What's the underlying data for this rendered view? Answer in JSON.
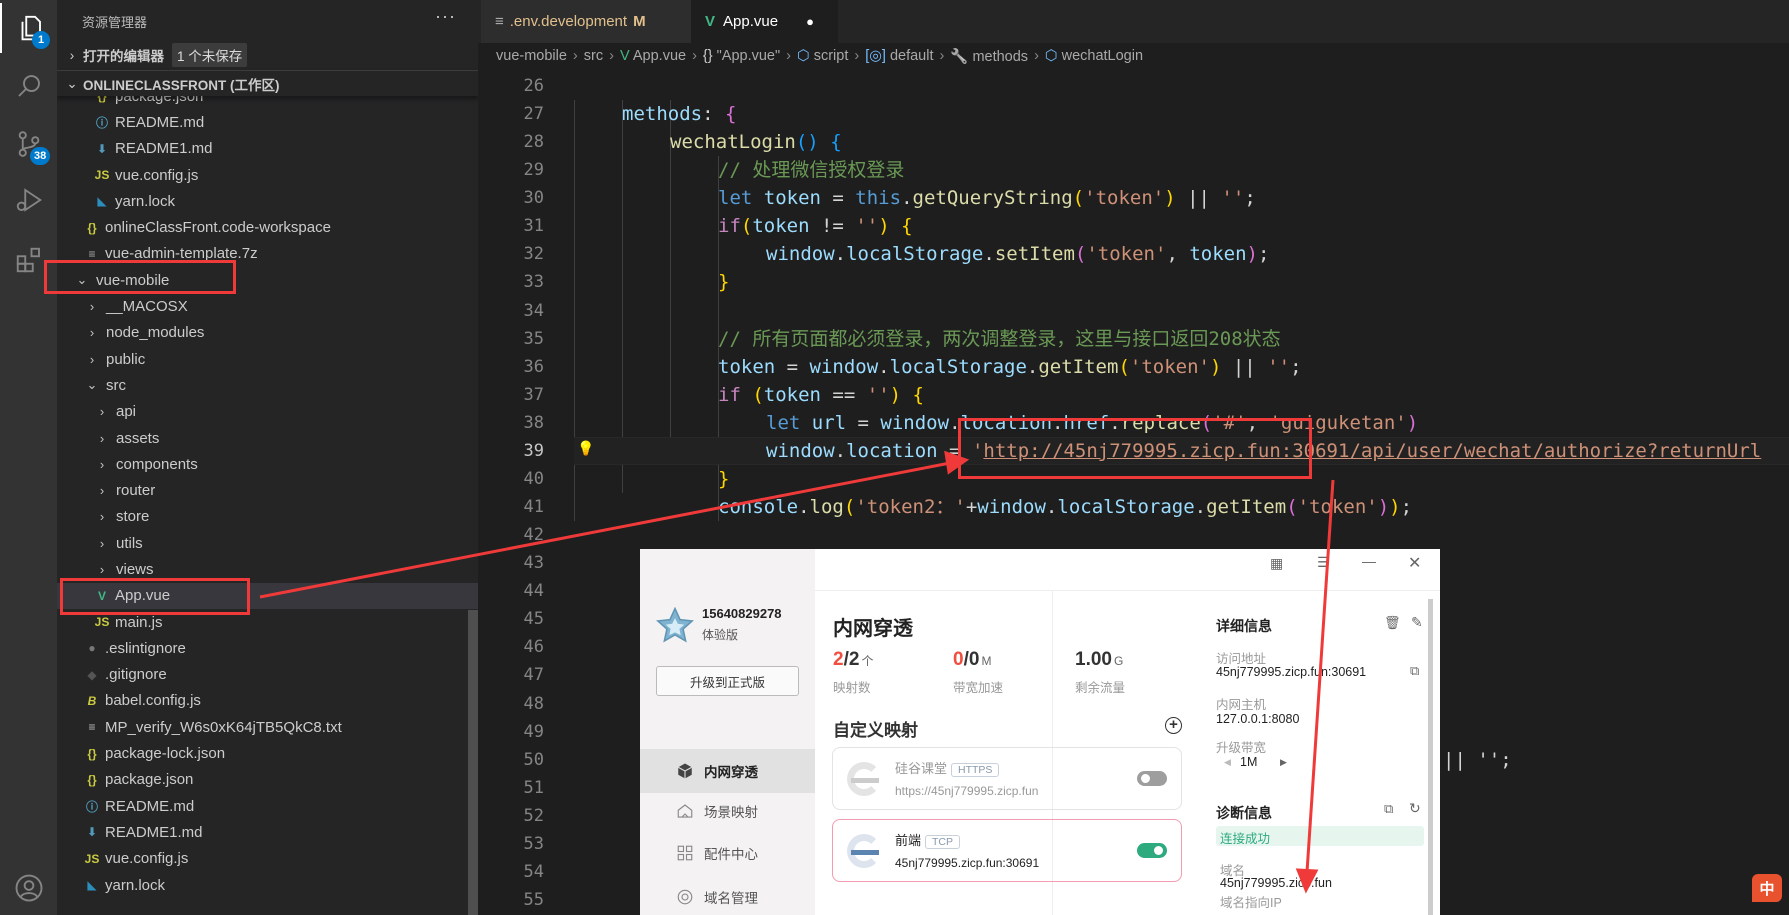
{
  "activity_bar": {
    "items": [
      {
        "icon": "files-icon",
        "badge": "1"
      },
      {
        "icon": "search-icon"
      },
      {
        "icon": "source-control-icon",
        "badge": "38"
      },
      {
        "icon": "run-debug-icon"
      },
      {
        "icon": "extensions-icon"
      }
    ],
    "account_icon": "account-icon"
  },
  "sidebar": {
    "title": "资源管理器",
    "more": "···",
    "open_editors": {
      "label": "打开的编辑器",
      "badge": "1 个未保存"
    },
    "workspace": {
      "label": "ONLINECLASSFRONT (工作区)"
    },
    "tree": [
      {
        "label": "package.json",
        "icon": "json",
        "depth": 2
      },
      {
        "label": "README.md",
        "icon": "info",
        "depth": 2
      },
      {
        "label": "README1.md",
        "icon": "md",
        "depth": 2
      },
      {
        "label": "vue.config.js",
        "icon": "js",
        "depth": 2
      },
      {
        "label": "yarn.lock",
        "icon": "yarn",
        "depth": 2
      },
      {
        "label": "onlineClassFront.code-workspace",
        "icon": "json",
        "depth": 1
      },
      {
        "label": "vue-admin-template.7z",
        "icon": "archive",
        "depth": 1
      },
      {
        "label": "vue-mobile",
        "folder": "open",
        "depth": 0
      },
      {
        "label": "__MACOSX",
        "folder": "closed",
        "depth": 1
      },
      {
        "label": "node_modules",
        "folder": "closed",
        "depth": 1
      },
      {
        "label": "public",
        "folder": "closed",
        "depth": 1
      },
      {
        "label": "src",
        "folder": "open",
        "depth": 1
      },
      {
        "label": "api",
        "folder": "closed",
        "depth": 2
      },
      {
        "label": "assets",
        "folder": "closed",
        "depth": 2
      },
      {
        "label": "components",
        "folder": "closed",
        "depth": 2
      },
      {
        "label": "router",
        "folder": "closed",
        "depth": 2
      },
      {
        "label": "store",
        "folder": "closed",
        "depth": 2
      },
      {
        "label": "utils",
        "folder": "closed",
        "depth": 2
      },
      {
        "label": "views",
        "folder": "closed",
        "depth": 2
      },
      {
        "label": "App.vue",
        "icon": "vue",
        "depth": 2,
        "selected": true
      },
      {
        "label": "main.js",
        "icon": "js",
        "depth": 2
      },
      {
        "label": ".eslintignore",
        "icon": "dot",
        "depth": 1
      },
      {
        "label": ".gitignore",
        "icon": "git",
        "depth": 1
      },
      {
        "label": "babel.config.js",
        "icon": "babel",
        "depth": 1
      },
      {
        "label": "MP_verify_W6s0xK64jTB5QkC8.txt",
        "icon": "txt",
        "depth": 1
      },
      {
        "label": "package-lock.json",
        "icon": "json",
        "depth": 1
      },
      {
        "label": "package.json",
        "icon": "json",
        "depth": 1
      },
      {
        "label": "README.md",
        "icon": "info",
        "depth": 1
      },
      {
        "label": "README1.md",
        "icon": "md",
        "depth": 1
      },
      {
        "label": "vue.config.js",
        "icon": "js",
        "depth": 1
      },
      {
        "label": "yarn.lock",
        "icon": "yarn",
        "depth": 1
      }
    ]
  },
  "tabs": [
    {
      "label": ".env.development",
      "status": "M",
      "icon": "file-lines-icon",
      "active": false
    },
    {
      "label": "App.vue",
      "status": "●",
      "icon": "vue-icon",
      "active": true
    }
  ],
  "breadcrumb": [
    {
      "label": "vue-mobile"
    },
    {
      "label": "src"
    },
    {
      "label": "App.vue",
      "icon": "vue-icon"
    },
    {
      "label": "\"App.vue\"",
      "icon": "braces-icon"
    },
    {
      "label": "script",
      "icon": "cube-icon"
    },
    {
      "label": "default",
      "icon": "module-icon"
    },
    {
      "label": "methods",
      "icon": "wrench-icon"
    },
    {
      "label": "wechatLogin",
      "icon": "cube-icon"
    }
  ],
  "editor": {
    "current_line": 39,
    "lines": [
      {
        "n": "26",
        "indent": 0,
        "tokens": []
      },
      {
        "n": "27",
        "indent": 1,
        "tokens": [
          {
            "t": "methods",
            "k": "var"
          },
          {
            "t": ": ",
            "k": "p"
          },
          {
            "t": "{",
            "k": "b2"
          }
        ]
      },
      {
        "n": "28",
        "indent": 2,
        "tokens": [
          {
            "t": "wechatLogin",
            "k": "fn"
          },
          {
            "t": "()",
            "k": "b3"
          },
          {
            "t": " ",
            "k": "p"
          },
          {
            "t": "{",
            "k": "b3"
          }
        ]
      },
      {
        "n": "29",
        "indent": 3,
        "tokens": [
          {
            "t": "// 处理微信授权登录",
            "k": "cm"
          }
        ]
      },
      {
        "n": "30",
        "indent": 3,
        "tokens": [
          {
            "t": "let ",
            "k": "kw"
          },
          {
            "t": "token",
            "k": "var"
          },
          {
            "t": " = ",
            "k": "p"
          },
          {
            "t": "this",
            "k": "kw"
          },
          {
            "t": ".",
            "k": "p"
          },
          {
            "t": "getQueryString",
            "k": "fn"
          },
          {
            "t": "(",
            "k": "b1"
          },
          {
            "t": "'token'",
            "k": "str"
          },
          {
            "t": ")",
            "k": "b1"
          },
          {
            "t": " || ",
            "k": "p"
          },
          {
            "t": "''",
            "k": "str"
          },
          {
            "t": ";",
            "k": "p"
          }
        ]
      },
      {
        "n": "31",
        "indent": 3,
        "tokens": [
          {
            "t": "if",
            "k": "ctl"
          },
          {
            "t": "(",
            "k": "b1"
          },
          {
            "t": "token",
            "k": "var"
          },
          {
            "t": " != ",
            "k": "p"
          },
          {
            "t": "''",
            "k": "str"
          },
          {
            "t": ")",
            "k": "b1"
          },
          {
            "t": " ",
            "k": "p"
          },
          {
            "t": "{",
            "k": "b1"
          }
        ]
      },
      {
        "n": "32",
        "indent": 4,
        "tokens": [
          {
            "t": "window",
            "k": "var"
          },
          {
            "t": ".",
            "k": "p"
          },
          {
            "t": "localStorage",
            "k": "var"
          },
          {
            "t": ".",
            "k": "p"
          },
          {
            "t": "setItem",
            "k": "fn"
          },
          {
            "t": "(",
            "k": "b2"
          },
          {
            "t": "'token'",
            "k": "str"
          },
          {
            "t": ", ",
            "k": "p"
          },
          {
            "t": "token",
            "k": "var"
          },
          {
            "t": ")",
            "k": "b2"
          },
          {
            "t": ";",
            "k": "p"
          }
        ]
      },
      {
        "n": "33",
        "indent": 3,
        "tokens": [
          {
            "t": "}",
            "k": "b1"
          }
        ]
      },
      {
        "n": "34",
        "indent": 0,
        "tokens": []
      },
      {
        "n": "35",
        "indent": 3,
        "tokens": [
          {
            "t": "// 所有页面都必须登录，两次调整登录，这里与接口返回208状态",
            "k": "cm"
          }
        ]
      },
      {
        "n": "36",
        "indent": 3,
        "tokens": [
          {
            "t": "token",
            "k": "var"
          },
          {
            "t": " = ",
            "k": "p"
          },
          {
            "t": "window",
            "k": "var"
          },
          {
            "t": ".",
            "k": "p"
          },
          {
            "t": "localStorage",
            "k": "var"
          },
          {
            "t": ".",
            "k": "p"
          },
          {
            "t": "getItem",
            "k": "fn"
          },
          {
            "t": "(",
            "k": "b1"
          },
          {
            "t": "'token'",
            "k": "str"
          },
          {
            "t": ")",
            "k": "b1"
          },
          {
            "t": " || ",
            "k": "p"
          },
          {
            "t": "''",
            "k": "str"
          },
          {
            "t": ";",
            "k": "p"
          }
        ]
      },
      {
        "n": "37",
        "indent": 3,
        "tokens": [
          {
            "t": "if",
            "k": "ctl"
          },
          {
            "t": " (",
            "k": "b1"
          },
          {
            "t": "token",
            "k": "var"
          },
          {
            "t": " == ",
            "k": "p"
          },
          {
            "t": "''",
            "k": "str"
          },
          {
            "t": ")",
            "k": "b1"
          },
          {
            "t": " ",
            "k": "p"
          },
          {
            "t": "{",
            "k": "b1"
          }
        ]
      },
      {
        "n": "38",
        "indent": 4,
        "tokens": [
          {
            "t": "let ",
            "k": "kw"
          },
          {
            "t": "url",
            "k": "var"
          },
          {
            "t": " = ",
            "k": "p"
          },
          {
            "t": "window",
            "k": "var"
          },
          {
            "t": ".",
            "k": "p"
          },
          {
            "t": "location",
            "k": "var"
          },
          {
            "t": ".",
            "k": "p"
          },
          {
            "t": "href",
            "k": "var"
          },
          {
            "t": ".",
            "k": "p"
          },
          {
            "t": "replace",
            "k": "fn"
          },
          {
            "t": "(",
            "k": "b2"
          },
          {
            "t": "'#'",
            "k": "str"
          },
          {
            "t": ", ",
            "k": "p"
          },
          {
            "t": "'guiguketan'",
            "k": "str"
          },
          {
            "t": ")",
            "k": "b2"
          }
        ]
      },
      {
        "n": "39",
        "indent": 4,
        "tokens": [
          {
            "t": "window",
            "k": "var"
          },
          {
            "t": ".",
            "k": "p"
          },
          {
            "t": "location",
            "k": "var"
          },
          {
            "t": " = ",
            "k": "p"
          },
          {
            "t": "'",
            "k": "str"
          },
          {
            "t": "http://45nj779995.zicp.fun:30691/api/user/wechat/authorize?returnUrl",
            "k": "str url"
          }
        ]
      },
      {
        "n": "40",
        "indent": 3,
        "tokens": [
          {
            "t": "}",
            "k": "b1"
          }
        ]
      },
      {
        "n": "41",
        "indent": 3,
        "tokens": [
          {
            "t": "console",
            "k": "var"
          },
          {
            "t": ".",
            "k": "p"
          },
          {
            "t": "log",
            "k": "fn"
          },
          {
            "t": "(",
            "k": "b1"
          },
          {
            "t": "'token2：'",
            "k": "str"
          },
          {
            "t": "+",
            "k": "p"
          },
          {
            "t": "window",
            "k": "var"
          },
          {
            "t": ".",
            "k": "p"
          },
          {
            "t": "localStorage",
            "k": "var"
          },
          {
            "t": ".",
            "k": "p"
          },
          {
            "t": "getItem",
            "k": "fn"
          },
          {
            "t": "(",
            "k": "b2"
          },
          {
            "t": "'token'",
            "k": "str"
          },
          {
            "t": ")",
            "k": "b2"
          },
          {
            "t": ")",
            "k": "b1"
          },
          {
            "t": ";",
            "k": "p"
          }
        ]
      },
      {
        "n": "42",
        "indent": 0,
        "tokens": []
      },
      {
        "n": "43",
        "indent": 0,
        "tokens": []
      },
      {
        "n": "44",
        "indent": 0,
        "tokens": []
      },
      {
        "n": "45",
        "indent": 0,
        "tokens": []
      },
      {
        "n": "46",
        "indent": 0,
        "tokens": []
      },
      {
        "n": "47",
        "indent": 0,
        "tokens": []
      },
      {
        "n": "48",
        "indent": 0,
        "tokens": []
      },
      {
        "n": "49",
        "indent": 0,
        "tokens": []
      },
      {
        "n": "50",
        "indent": 0,
        "tokens": []
      },
      {
        "n": "51",
        "indent": 0,
        "tokens": []
      },
      {
        "n": "52",
        "indent": 0,
        "tokens": []
      },
      {
        "n": "53",
        "indent": 0,
        "tokens": []
      },
      {
        "n": "54",
        "indent": 0,
        "tokens": []
      },
      {
        "n": "55",
        "indent": 0,
        "tokens": []
      }
    ],
    "line50_visible_tail": "|| '';"
  },
  "tunnel_app": {
    "account": {
      "phone": "15640829278",
      "plan": "体验版",
      "upgrade_button": "升级到正式版"
    },
    "nav": [
      {
        "label": "内网穿透",
        "icon": "cube-icon",
        "active": true
      },
      {
        "label": "场景映射",
        "icon": "home-icon"
      },
      {
        "label": "配件中心",
        "icon": "grid-icon"
      },
      {
        "label": "域名管理",
        "icon": "domain-icon"
      }
    ],
    "window_controls": [
      "qr-code-icon",
      "menu-icon",
      "minimize-icon",
      "close-icon"
    ],
    "title": "内网穿透",
    "stats": [
      {
        "value_used": "2",
        "value_total": "/2",
        "unit": "个",
        "label": "映射数"
      },
      {
        "value_used": "0",
        "value_total": "/0",
        "unit": "M",
        "label": "带宽加速"
      },
      {
        "value_used": "",
        "value_total": "1.00",
        "unit": "G",
        "label": "剩余流量"
      }
    ],
    "custom_mapping_title": "自定义映射",
    "mappings": [
      {
        "name": "硅谷课堂",
        "protocol": "HTTPS",
        "address": "https://45nj779995.zicp.fun",
        "enabled": false
      },
      {
        "name": "前端",
        "protocol": "TCP",
        "address": "45nj779995.zicp.fun:30691",
        "enabled": true
      }
    ],
    "details": {
      "title": "详细信息",
      "access_label": "访问地址",
      "access_value": "45nj779995.zicp.fun:30691",
      "host_label": "内网主机",
      "host_value": "127.0.0.1:8080",
      "bandwidth_label": "升级带宽",
      "bandwidth_value": "1M"
    },
    "diagnostics": {
      "title": "诊断信息",
      "status": "连接成功",
      "domain_label": "域名",
      "domain_value": "45nj779995.zicp.fun",
      "ip_label": "域名指向IP"
    }
  },
  "ime_indicator": "中",
  "colors": {
    "annotation_red": "#f03a3a",
    "accent": "#007acc",
    "toggle_on": "#2eaa7f",
    "toggle_off": "#9e9e9e",
    "success_bg": "#e6f6ef",
    "success_text": "#2eaa7f"
  }
}
